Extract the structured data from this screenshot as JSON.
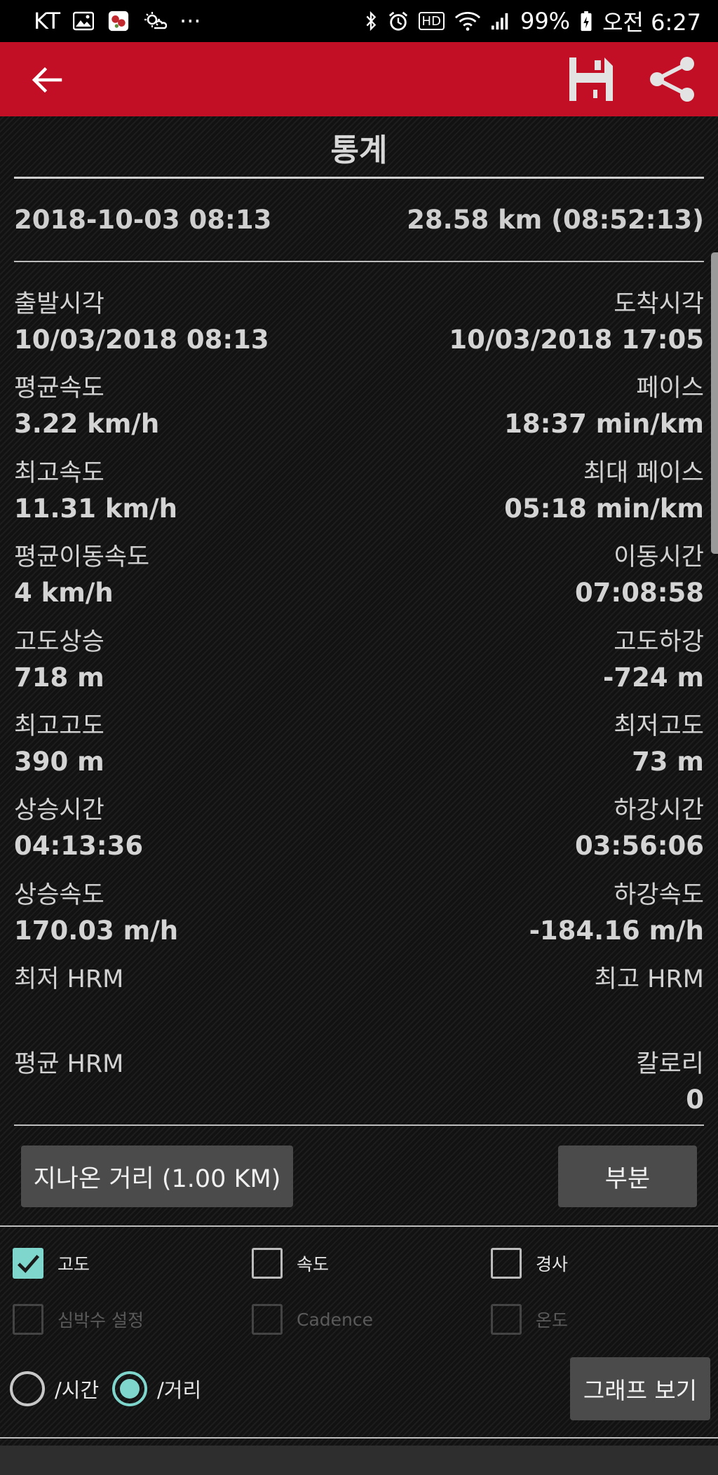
{
  "status_bar": {
    "carrier": "KT",
    "more": "···",
    "battery": "99%",
    "time": "오전 6:27",
    "hd_badge": "HD"
  },
  "app_bar": {
    "background": "#c20f25",
    "icons": [
      "arrow-left-icon",
      "save-icon",
      "share-icon"
    ]
  },
  "page": {
    "title": "통계"
  },
  "summary": {
    "date": "2018-10-03 08:13",
    "distance": "28.58 km (08:52:13)"
  },
  "stats": [
    {
      "left_label": "출발시각",
      "left_value": "10/03/2018 08:13",
      "right_label": "도착시각",
      "right_value": "10/03/2018 17:05"
    },
    {
      "left_label": "평균속도",
      "left_value": "3.22 km/h",
      "right_label": "페이스",
      "right_value": "18:37 min/km"
    },
    {
      "left_label": "최고속도",
      "left_value": "11.31 km/h",
      "right_label": "최대 페이스",
      "right_value": "05:18 min/km"
    },
    {
      "left_label": "평균이동속도",
      "left_value": "4 km/h",
      "right_label": "이동시간",
      "right_value": "07:08:58"
    },
    {
      "left_label": "고도상승",
      "left_value": "718 m",
      "right_label": "고도하강",
      "right_value": "-724 m"
    },
    {
      "left_label": "최고고도",
      "left_value": "390 m",
      "right_label": "최저고도",
      "right_value": "73 m"
    },
    {
      "left_label": "상승시간",
      "left_value": "04:13:36",
      "right_label": "하강시간",
      "right_value": "03:56:06"
    },
    {
      "left_label": "상승속도",
      "left_value": "170.03 m/h",
      "right_label": "하강속도",
      "right_value": "-184.16 m/h"
    },
    {
      "left_label": "최저 HRM",
      "left_value": "",
      "right_label": "최고 HRM",
      "right_value": ""
    },
    {
      "left_label": "평균 HRM",
      "left_value": "",
      "right_label": "칼로리",
      "right_value": "0"
    }
  ],
  "buttons": {
    "distance": "지나온 거리 (1.00  KM)",
    "partial": "부분",
    "show_graph": "그래프 보기"
  },
  "checkboxes": [
    {
      "label": "고도",
      "checked": true,
      "enabled": true
    },
    {
      "label": "속도",
      "checked": false,
      "enabled": true
    },
    {
      "label": "경사",
      "checked": false,
      "enabled": true
    },
    {
      "label": "심박수 설정",
      "checked": false,
      "enabled": false
    },
    {
      "label": "Cadence",
      "checked": false,
      "enabled": false
    },
    {
      "label": "온도",
      "checked": false,
      "enabled": false
    }
  ],
  "radios": [
    {
      "label": "/시간",
      "selected": false
    },
    {
      "label": "/거리",
      "selected": true
    }
  ],
  "colors": {
    "accent": "#7fd6cd",
    "button_bg": "#4b4b4b"
  }
}
